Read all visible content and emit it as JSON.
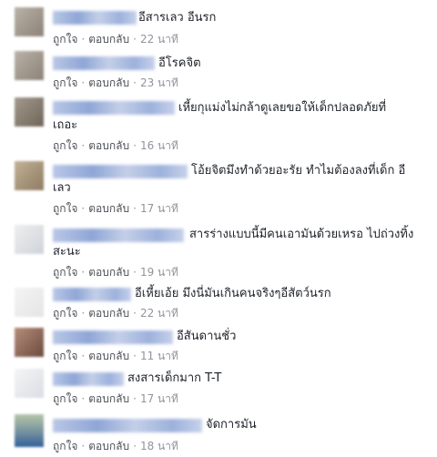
{
  "separator": "·",
  "comments": [
    {
      "text": "อีสารเลว อีนรก",
      "like": "ถูกใจ",
      "reply": "ตอบกลับ",
      "time": "22 นาที"
    },
    {
      "text": "อีโรคจิต",
      "like": "ถูกใจ",
      "reply": "ตอบกลับ",
      "time": "23 นาที"
    },
    {
      "text": "เหี้ยกุแม่งไม่กล้าดูเลยขอให้เด็กปลอดภัยที่",
      "text2": "เถอะ",
      "like": "ถูกใจ",
      "reply": "ตอบกลับ",
      "time": "16 นาที"
    },
    {
      "text": "โอ้ยจิตมึงทำด้วยอะรัย ทำไมต้องลงที่เด็ก อี",
      "text2": "เลว",
      "like": "ถูกใจ",
      "reply": "ตอบกลับ",
      "time": "17 นาที"
    },
    {
      "text": "สารร่างแบบนี้มีคนเอามันด้วยเหรอ ไปถ่วงทิ้ง",
      "text2": "สะนะ",
      "like": "ถูกใจ",
      "reply": "ตอบกลับ",
      "time": "19 นาที"
    },
    {
      "text": "อีเหี้ยเอ้ย มึงนี่มันเกินคนจริงๆอีสัตว์นรก",
      "like": "ถูกใจ",
      "reply": "ตอบกลับ",
      "time": "22 นาที"
    },
    {
      "text": "อีสันดานชั่ว",
      "like": "ถูกใจ",
      "reply": "ตอบกลับ",
      "time": "11 นาที"
    },
    {
      "text": "สงสารเด็กมาก T-T",
      "like": "ถูกใจ",
      "reply": "ตอบกลับ",
      "time": "17 นาที"
    },
    {
      "text": "จัดการมัน",
      "like": "ถูกใจ",
      "reply": "ตอบกลับ",
      "time": "18 นาที"
    }
  ]
}
